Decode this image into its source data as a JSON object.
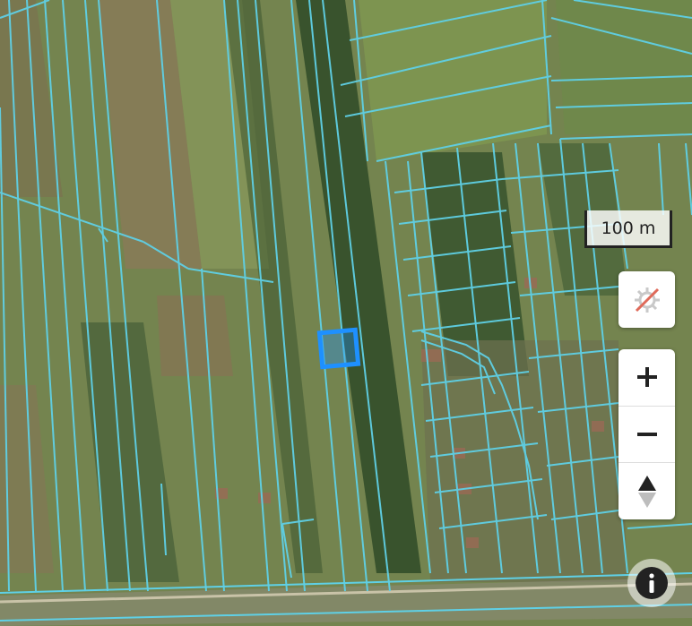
{
  "map": {
    "scale_label": "100 m",
    "colors": {
      "parcel_line": "#5fd0e6",
      "selected_parcel": "#1e90ff",
      "field_green": "#7c8f52",
      "field_brown": "#8b7656",
      "forest": "#2e4a25"
    }
  },
  "controls": {
    "gps_disabled_icon": "gear-crossed-icon",
    "zoom_in_icon": "plus-icon",
    "zoom_out_icon": "minus-icon",
    "compass_icon": "compass-arrow-icon",
    "info_icon": "info-icon"
  }
}
